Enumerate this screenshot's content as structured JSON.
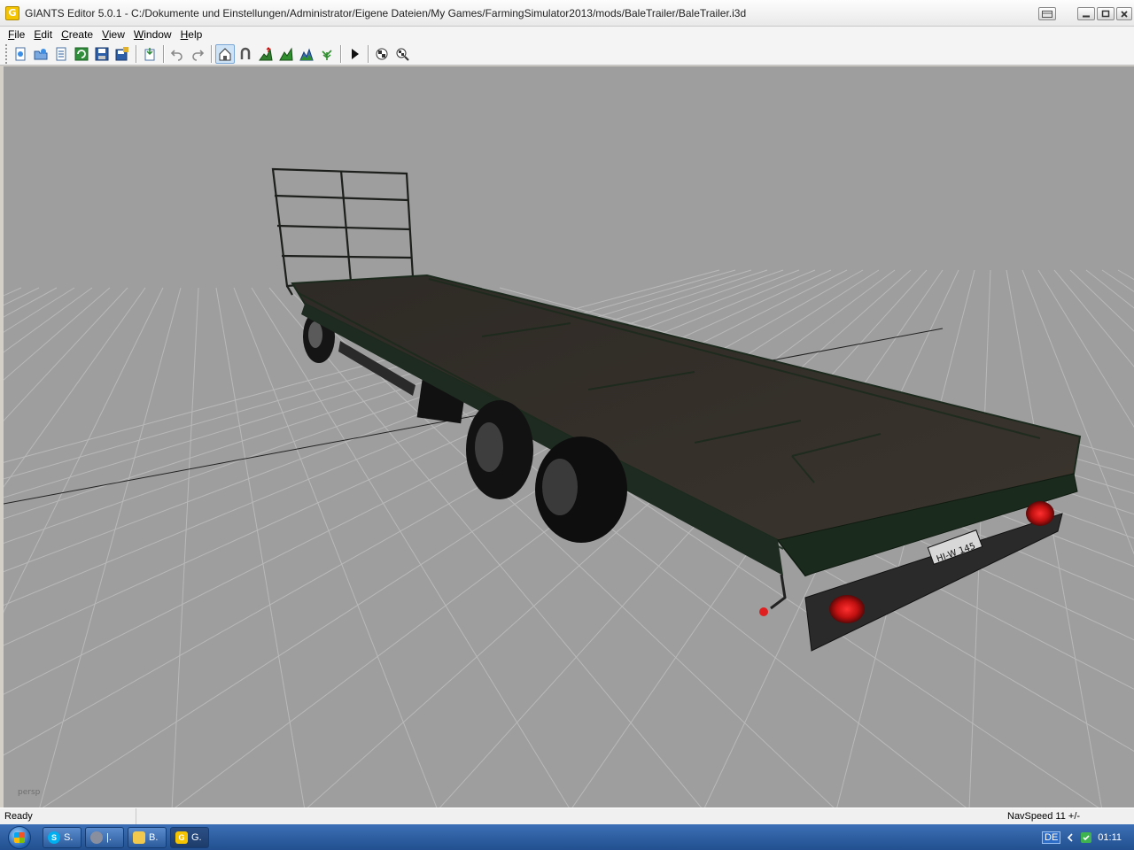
{
  "window": {
    "app_icon_letter": "G",
    "title": "GIANTS Editor 5.0.1 - C:/Dokumente und Einstellungen/Administrator/Eigene Dateien/My Games/FarmingSimulator2013/mods/BaleTrailer/BaleTrailer.i3d"
  },
  "menu": {
    "items": [
      {
        "accel": "F",
        "rest": "ile"
      },
      {
        "accel": "E",
        "rest": "dit"
      },
      {
        "accel": "C",
        "rest": "reate"
      },
      {
        "accel": "V",
        "rest": "iew"
      },
      {
        "accel": "W",
        "rest": "indow"
      },
      {
        "accel": "H",
        "rest": "elp"
      }
    ]
  },
  "toolbar": {
    "icons": [
      "new-file-icon",
      "open-file-icon",
      "list-icon",
      "reload-icon",
      "save-icon",
      "save-all-icon",
      "import-icon",
      "undo-icon",
      "redo-icon",
      "home-select-icon",
      "magnet-icon",
      "terrain-raise-icon",
      "terrain-paint-icon",
      "terrain-smooth-icon",
      "foliage-paint-icon",
      "play-icon",
      "checker-icon",
      "checker-zoom-icon"
    ]
  },
  "viewport": {
    "camera_label": "persp",
    "license_plate": "HI-W 145"
  },
  "status": {
    "left": "Ready",
    "nav_speed": "NavSpeed 11 +/-"
  },
  "taskbar": {
    "buttons": [
      {
        "label": "S.",
        "icon": "skype-icon",
        "color": "#00aff0"
      },
      {
        "label": "|.",
        "icon": "browser-icon",
        "color": "#8a8fa0"
      },
      {
        "label": "B.",
        "icon": "folder-icon",
        "color": "#f2c94c"
      },
      {
        "label": "G.",
        "icon": "giants-icon",
        "color": "#f5c400"
      }
    ],
    "language": "DE",
    "clock": "01:11"
  }
}
